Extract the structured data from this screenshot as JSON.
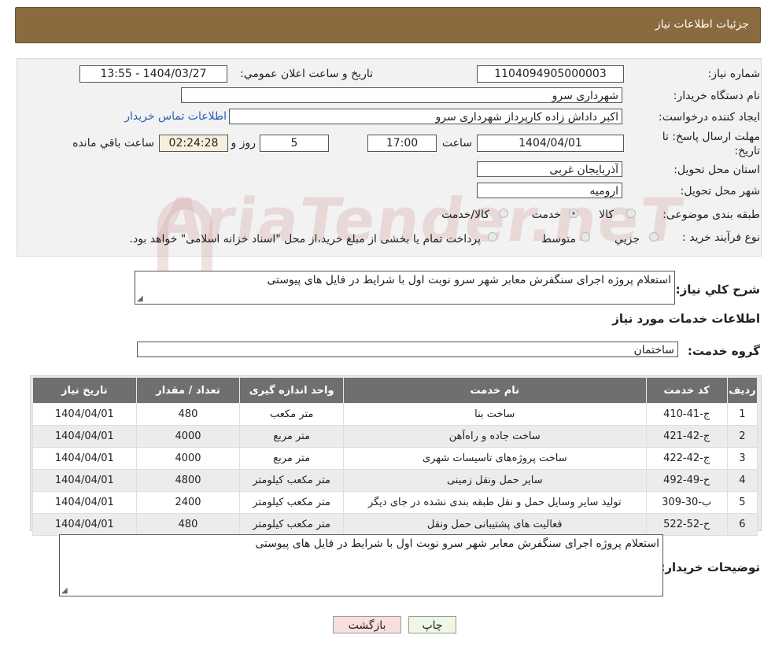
{
  "header": {
    "title": "جزئیات اطلاعات نیاز"
  },
  "form": {
    "need_number_label": "شماره نیاز:",
    "need_number": "1104094905000003",
    "announce_label": "تاریخ و ساعت اعلان عمومي:",
    "announce_value": "1404/03/27 - 13:55",
    "buyer_org_label": "نام دستگاه خريدار:",
    "buyer_org": "شهرداری سرو",
    "creator_label": "ايجاد کننده درخواست:",
    "creator": "اکبر داداش زاده کارپرداز شهرداری سرو",
    "contact_link": "اطلاعات تماس خريدار",
    "deadline_label_1": "مهلت ارسال پاسخ: تا",
    "deadline_label_2": "تاريخ:",
    "deadline_date": "1404/04/01",
    "time_label": "ساعت",
    "deadline_time": "17:00",
    "days_value": "5",
    "days_label": "روز و",
    "remaining_value": "02:24:28",
    "remaining_label": "ساعت باقي مانده",
    "province_label": "استان محل تحويل:",
    "province": "آذربايجان غربی",
    "city_label": "شهر محل تحويل:",
    "city": "ارومیه",
    "category_label": "طبقه بندی موضوعی:",
    "category_options": [
      "کالا",
      "خدمت",
      "کالا/خدمت"
    ],
    "category_selected": "خدمت",
    "process_label": "نوع فرآيند خريد :",
    "process_options": [
      "جزیي",
      "متوسط"
    ],
    "process_note": "پرداخت تمام یا بخشی از مبلغ خرید،از محل \"اسناد خزانه اسلامی\" خواهد بود.",
    "watermark": "AriaTender.neT"
  },
  "summary": {
    "label": "شرح کلي نياز:",
    "text": "استعلام پروژه اجرای سنگفرش معابر شهر سرو نوبت اول با شرایط در فایل های پیوستی"
  },
  "services": {
    "section_title": "اطلاعات خدمات مورد نياز",
    "group_label": "گروه خدمت:",
    "group_value": "ساختمان",
    "columns": [
      "رديف",
      "کد خدمت",
      "نام خدمت",
      "واحد اندازه گيری",
      "تعداد / مقدار",
      "تاريخ نياز"
    ],
    "rows": [
      [
        "1",
        "ج-41-410",
        "ساخت بنا",
        "متر مکعب",
        "480",
        "1404/04/01"
      ],
      [
        "2",
        "ج-42-421",
        "ساخت جاده و راه‌آهن",
        "متر مربع",
        "4000",
        "1404/04/01"
      ],
      [
        "3",
        "ج-42-422",
        "ساخت پروژه‌های تاسیسات شهری",
        "متر مربع",
        "4000",
        "1404/04/01"
      ],
      [
        "4",
        "ح-49-492",
        "سایر حمل ونقل زمینی",
        "متر مکعب کیلومتر",
        "4800",
        "1404/04/01"
      ],
      [
        "5",
        "ب-30-309",
        "تولید سایر وسایل حمل و نقل طبقه بندی نشده در جای دیگر",
        "متر مکعب کیلومتر",
        "2400",
        "1404/04/01"
      ],
      [
        "6",
        "ح-52-522",
        "فعالیت های پشتیبانی حمل ونقل",
        "متر مکعب کیلومتر",
        "480",
        "1404/04/01"
      ]
    ]
  },
  "buyer_notes": {
    "label": "توضيحات خريدار:",
    "text": "استعلام پروژه اجرای سنگفرش معابر شهر سرو نوبت اول با شرایط در فایل های پیوستی"
  },
  "buttons": {
    "print": "چاپ",
    "back": "بازگشت"
  }
}
